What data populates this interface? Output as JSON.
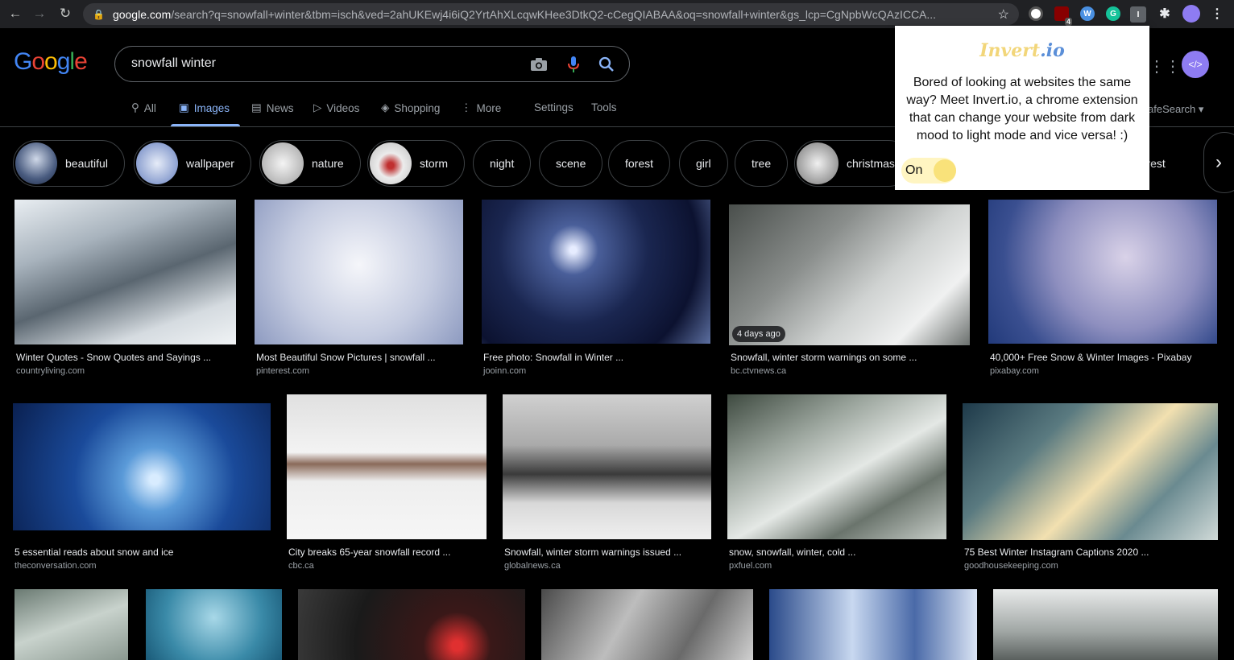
{
  "browser": {
    "url_domain": "google.com",
    "url_rest": "/search?q=snowfall+winter&tbm=isch&ved=2ahUKEwj4i6iQ2YrtAhXLcqwKHee3DtkQ2-cCegQIABAA&oq=snowfall+winter&gs_lcp=CgNpbWcQAzICCA...",
    "ext_badge": "4"
  },
  "google": {
    "logo": "Google",
    "query": "snowfall winter",
    "tabs": [
      {
        "label": "All"
      },
      {
        "label": "Images"
      },
      {
        "label": "News"
      },
      {
        "label": "Videos"
      },
      {
        "label": "Shopping"
      },
      {
        "label": "More"
      }
    ],
    "settings": "Settings",
    "tools": "Tools",
    "safesearch": "afeSearch ▾"
  },
  "chips": [
    {
      "label": "beautiful"
    },
    {
      "label": "wallpaper"
    },
    {
      "label": "nature"
    },
    {
      "label": "storm"
    },
    {
      "label": "night"
    },
    {
      "label": "scene"
    },
    {
      "label": "forest"
    },
    {
      "label": "girl"
    },
    {
      "label": "tree"
    },
    {
      "label": "christmas"
    },
    {
      "label": "nterest"
    }
  ],
  "results": [
    {
      "title": "Winter Quotes - Snow Quotes and Sayings ...",
      "source": "countryliving.com"
    },
    {
      "title": "Most Beautiful Snow Pictures | snowfall ...",
      "source": "pinterest.com"
    },
    {
      "title": "Free photo: Snowfall in Winter ...",
      "source": "jooinn.com"
    },
    {
      "title": "Snowfall, winter storm warnings on some ...",
      "source": "bc.ctvnews.ca",
      "badge": "4 days ago"
    },
    {
      "title": "40,000+ Free Snow & Winter Images - Pixabay",
      "source": "pixabay.com"
    },
    {
      "title": "5 essential reads about snow and ice",
      "source": "theconversation.com"
    },
    {
      "title": "City breaks 65-year snowfall record ...",
      "source": "cbc.ca"
    },
    {
      "title": "Snowfall, winter storm warnings issued ...",
      "source": "globalnews.ca"
    },
    {
      "title": "snow, snowfall, winter, cold ...",
      "source": "pxfuel.com"
    },
    {
      "title": "75 Best Winter Instagram Captions 2020 ...",
      "source": "goodhousekeeping.com"
    }
  ],
  "popup": {
    "brand_main": "Invert",
    "brand_tld": ".io",
    "description": "Bored of looking at websites the same way? Meet Invert.io, a chrome extension that can change your website from dark mood to light mode and vice versa! :)",
    "toggle_label": "On"
  },
  "colors": {
    "accent": "#8ab4f8",
    "popup_brand": "#f2d67a",
    "toggle_knob": "#f9e27a"
  }
}
